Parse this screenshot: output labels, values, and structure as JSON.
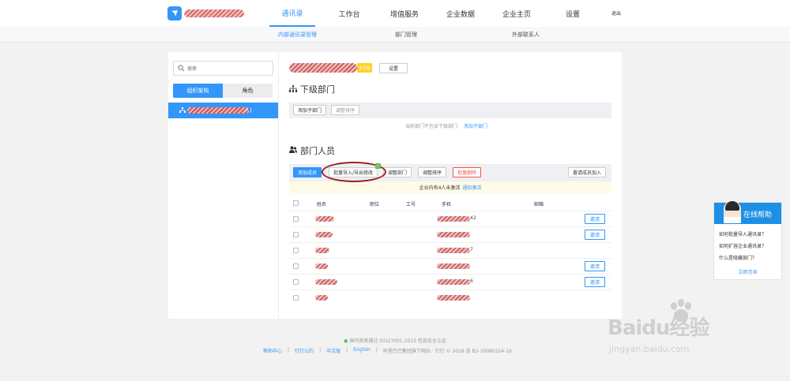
{
  "header": {
    "nav": [
      "通讯录",
      "工作台",
      "增值服务",
      "企业数据",
      "企业主页",
      "设置"
    ],
    "logout": "退出"
  },
  "subnav": [
    "内部通讯录管理",
    "部门管理",
    "外部联系人"
  ],
  "sidebar": {
    "search_placeholder": "搜索",
    "tab_org": "组织架构",
    "tab_role": "角色",
    "tree_suffix": "人)"
  },
  "main": {
    "badge": "全员群",
    "settings_btn": "设置",
    "sub_dept_title": "下级部门",
    "add_sub_dept": "添加子部门",
    "adjust_sort": "调整排序",
    "empty_text": "当前部门不包含下级部门",
    "empty_link": "添加子部门",
    "members_title": "部门人员",
    "add_member": "添加成员",
    "batch_import": "批量导入/导出修改",
    "adjust_dept": "调整部门",
    "adjust_sort2": "调整排序",
    "batch_delete": "批量删除",
    "invite_join": "邀请成员加入",
    "notice_text": "企业内有4人未激活",
    "notice_link": "通知激活",
    "columns": [
      "姓名",
      "职位",
      "工号",
      "手机",
      "邮箱"
    ],
    "rows": [
      {
        "phone_tail": "42",
        "invite": "邀请"
      },
      {
        "phone_tail": "",
        "invite": "邀请"
      },
      {
        "phone_tail": "7",
        "invite": ""
      },
      {
        "phone_tail": "",
        "invite": "邀请"
      },
      {
        "phone_tail": "6",
        "invite": "邀请"
      },
      {
        "phone_tail": "",
        "invite": ""
      }
    ]
  },
  "footer": {
    "cert": "国内首家通过 ISO27001:2013 信息安全认证",
    "links": [
      "帮助中心",
      "钉钉公约",
      "中文版",
      "English"
    ],
    "copyright": "阿里巴巴集团旗下网站 · 钉钉 © 2018 浙 B2-20080224-16"
  },
  "help": {
    "title": "在线帮助",
    "questions": [
      "如何批量导入通讯录？",
      "如何扩容企业通讯录？",
      "什么是隐藏部门？"
    ],
    "consult": "立即咨询"
  },
  "watermark": {
    "brand": "Baidu经验",
    "url": "jingyan.baidu.com"
  },
  "colors": {
    "accent": "#3296fa",
    "danger": "#f25643",
    "badge": "#ffd21f"
  }
}
